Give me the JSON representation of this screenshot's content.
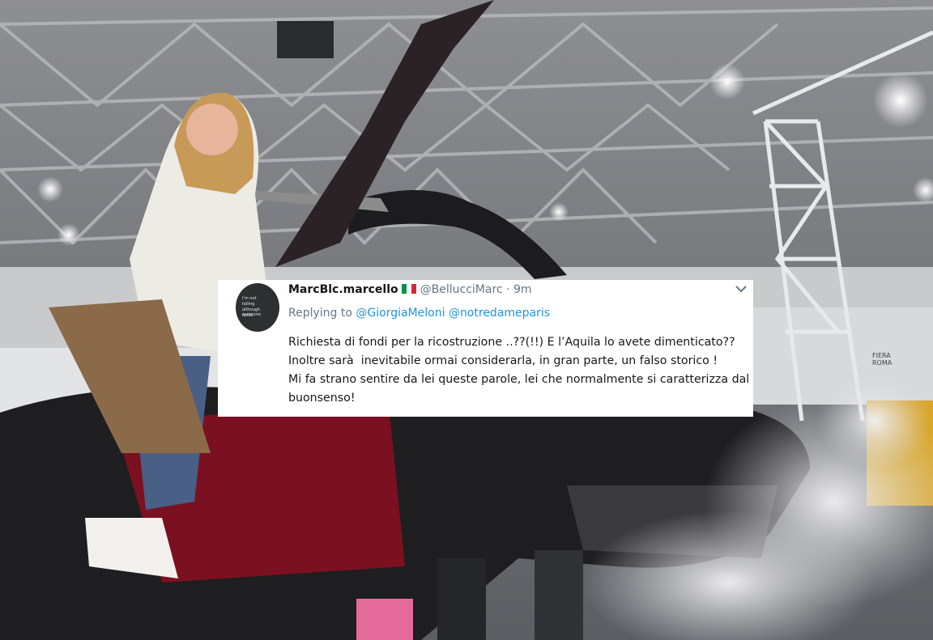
{
  "tweet": {
    "display_name": "MarcBlc.marcello",
    "handle": "@BellucciMarc",
    "separator": "·",
    "time": "9m",
    "replying_label": "Replying to",
    "mentions": [
      "@GiorgiaMeloni",
      "@notredameparis"
    ],
    "body_lines": [
      "Richiesta di fondi per la ricostruzione ..??(!!) E l’Aquila lo avete dimenticato??",
      "Inoltre sarà  inevitabile ormai considerarla, in gran parte, un falso storico !",
      "Mi fa strano sentire da lei queste parole, lei che normalmente si caratterizza dal",
      "buonsenso!"
    ],
    "avatar_text": [
      "I'm not",
      "falling",
      "although someone",
      "lands"
    ],
    "flag_colors": [
      "#009246",
      "#ffffff",
      "#ce2b37"
    ],
    "menu_icon": "chevron-down-icon"
  },
  "background_sign": [
    "FIERA",
    "ROMA"
  ]
}
